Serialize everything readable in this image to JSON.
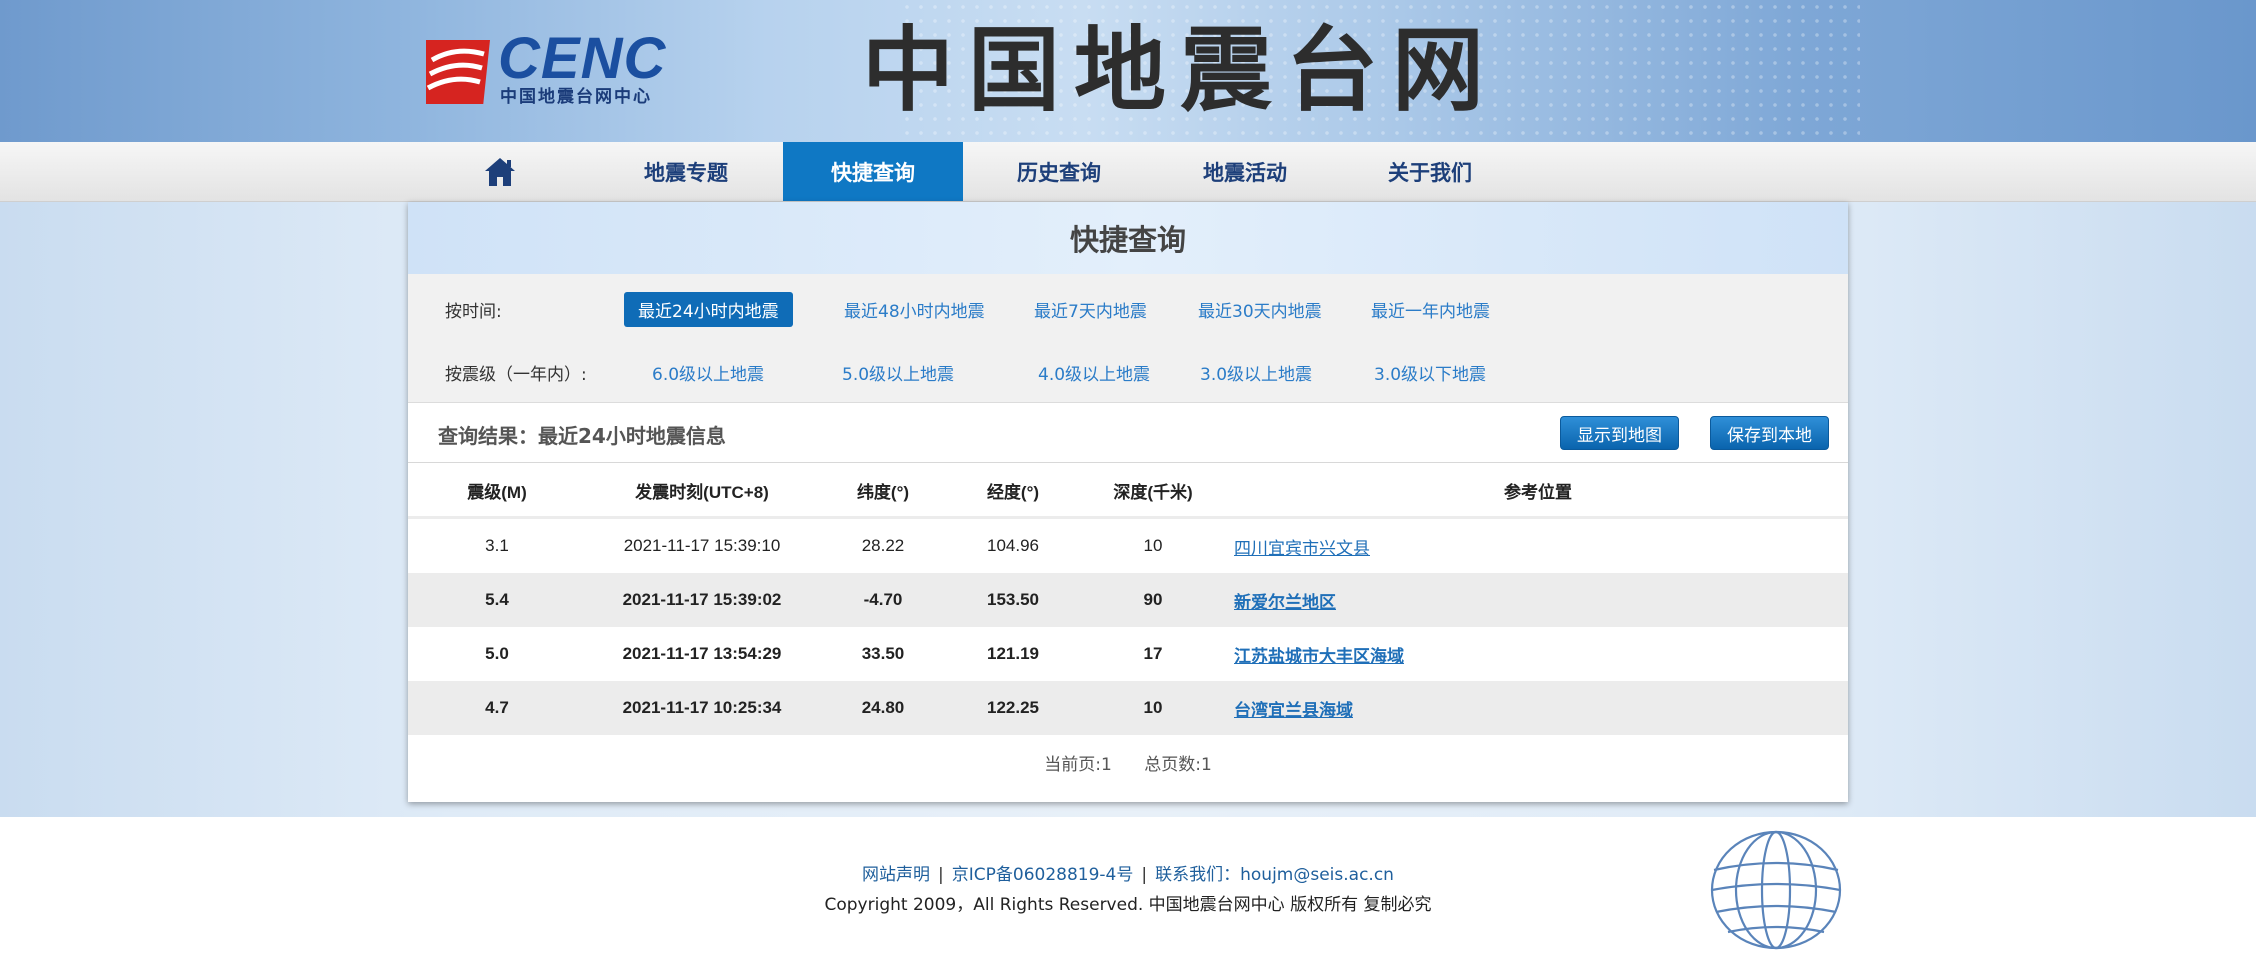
{
  "header": {
    "logo_text": "CENC",
    "logo_sub": "中国地震台网中心",
    "site_title": "中国地震台网"
  },
  "nav": [
    {
      "label": "",
      "icon": "home-icon"
    },
    {
      "label": "地震专题"
    },
    {
      "label": "快捷查询",
      "active": true
    },
    {
      "label": "历史查询"
    },
    {
      "label": "地震活动"
    },
    {
      "label": "关于我们"
    }
  ],
  "panel": {
    "title": "快捷查询",
    "by_time_label": "按时间:",
    "time_filters": [
      "最近24小时内地震",
      "最近48小时内地震",
      "最近7天内地震",
      "最近30天内地震",
      "最近一年内地震"
    ],
    "by_mag_label": "按震级（一年内）:",
    "mag_filters": [
      "6.0级以上地震",
      "5.0级以上地震",
      "4.0级以上地震",
      "3.0级以上地震",
      "3.0级以下地震"
    ],
    "result_title": "查询结果：最近24小时地震信息",
    "show_map_button": "显示到地图",
    "save_button": "保存到本地",
    "columns": [
      "震级(M)",
      "发震时刻(UTC+8)",
      "纬度(°)",
      "经度(°)",
      "深度(千米)",
      "参考位置"
    ],
    "rows": [
      {
        "mag": "3.1",
        "time": "2021-11-17 15:39:10",
        "lat": "28.22",
        "lon": "104.96",
        "depth": "10",
        "loc": "四川宜宾市兴文县"
      },
      {
        "mag": "5.4",
        "time": "2021-11-17 15:39:02",
        "lat": "-4.70",
        "lon": "153.50",
        "depth": "90",
        "loc": "新爱尔兰地区"
      },
      {
        "mag": "5.0",
        "time": "2021-11-17 13:54:29",
        "lat": "33.50",
        "lon": "121.19",
        "depth": "17",
        "loc": "江苏盐城市大丰区海域"
      },
      {
        "mag": "4.7",
        "time": "2021-11-17 10:25:34",
        "lat": "24.80",
        "lon": "122.25",
        "depth": "10",
        "loc": "台湾宜兰县海域"
      }
    ],
    "pager": {
      "current": "当前页:1",
      "total": "总页数:1"
    }
  },
  "footer": {
    "link1": "网站声明",
    "link2": "京ICP备06028819-4号",
    "contact_label": "联系我们：",
    "contact_email": "houjm@seis.ac.cn",
    "copyright": "Copyright 2009，All Rights Reserved. 中国地震台网中心 版权所有 复制必究"
  },
  "colors": {
    "accent": "#0f78c4",
    "link": "#2b7cc8",
    "nav_text": "#1d3f7a"
  }
}
